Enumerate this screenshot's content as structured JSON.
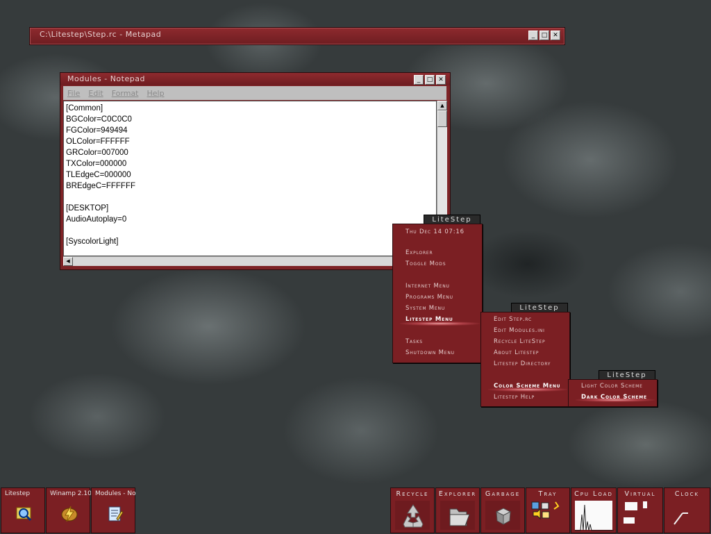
{
  "metapad": {
    "title": "C:\\Litestep\\Step.rc - Metapad",
    "btn_min": "_",
    "btn_max": "□",
    "btn_close": "✕"
  },
  "notepad": {
    "title": "Modules - Notepad",
    "btn_min": "_",
    "btn_max": "□",
    "btn_close": "✕",
    "menu": [
      "File",
      "Edit",
      "Format",
      "Help"
    ],
    "content": "[Common]\nBGColor=C0C0C0\nFGColor=949494\nOLColor=FFFFFF\nGRColor=007000\nTXColor=000000\nTLEdgeC=000000\nBREdgeC=FFFFFF\n\n[DESKTOP]\nAudioAutoplay=0\n\n[SyscolorLight]"
  },
  "main_menu": {
    "header": "LiteStep",
    "date": "Thu Dec 14 07:16",
    "items": [
      "Explorer",
      "Toggle Mods",
      "Internet Menu",
      "Programs Menu",
      "System Menu",
      "Litestep Menu",
      "Tasks",
      "Shutdown Menu"
    ]
  },
  "litestep_menu": {
    "header": "LiteStep",
    "items": [
      "Edit Step.rc",
      "Edit Modules.ini",
      "Recycle LiteStep",
      "About Litestep",
      "Litestep Directory",
      "Color Scheme Menu",
      "Litestep Help"
    ]
  },
  "color_menu": {
    "header": "LiteStep",
    "items": [
      "Light Color Scheme",
      "Dark Color Scheme"
    ]
  },
  "taskbar": {
    "tasks": [
      {
        "label": "Litestep",
        "icon": "explorer-search-icon"
      },
      {
        "label": "Winamp 2.10",
        "icon": "winamp-bolt-icon"
      },
      {
        "label": "Modules - No",
        "icon": "notepad-icon"
      }
    ],
    "wharf": [
      "Recycle",
      "Explorer",
      "Garbage",
      "Tray",
      "Cpu Load",
      "Virtual",
      "Clock"
    ]
  },
  "colors": {
    "accent": "#7b1f23",
    "titlebar": "#8e2a2e",
    "desktop": "#363b3c"
  }
}
